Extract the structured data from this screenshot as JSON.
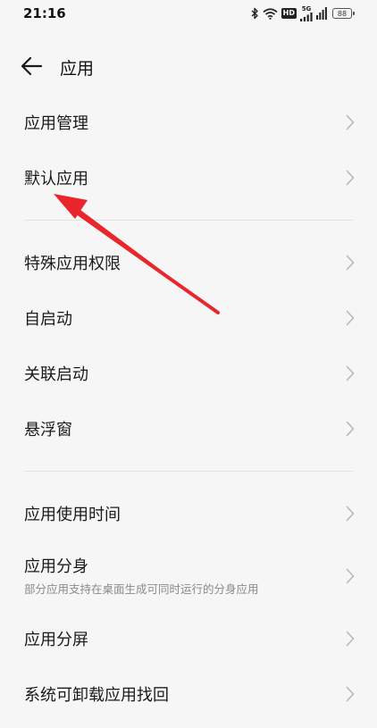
{
  "status_bar": {
    "time": "21:16",
    "hd_label": "HD",
    "network_label": "5G",
    "battery_level": "88",
    "icons": [
      "bluetooth-icon",
      "wifi-icon",
      "hd-icon",
      "signal-icon",
      "battery-icon"
    ]
  },
  "header": {
    "back_icon": "arrow-left-icon",
    "title": "应用"
  },
  "group1": {
    "items": [
      {
        "label": "应用管理"
      },
      {
        "label": "默认应用"
      }
    ]
  },
  "group2": {
    "items": [
      {
        "label": "特殊应用权限"
      },
      {
        "label": "自启动"
      },
      {
        "label": "关联启动"
      },
      {
        "label": "悬浮窗"
      }
    ]
  },
  "group3": {
    "items": [
      {
        "label": "应用使用时间"
      },
      {
        "label": "应用分身",
        "subtitle": "部分应用支持在桌面生成可同时运行的分身应用"
      },
      {
        "label": "应用分屏"
      },
      {
        "label": "系统可卸载应用找回"
      }
    ]
  },
  "colors": {
    "background": "#f6f6f6",
    "text": "#1a1a1a",
    "subtext": "#8a8a8a",
    "chevron": "#b8b8b8",
    "annotation_arrow": "#e8262b"
  }
}
